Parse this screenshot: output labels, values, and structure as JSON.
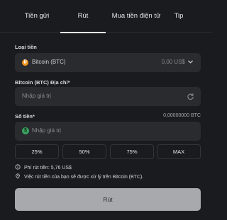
{
  "tabs": [
    {
      "label": "Tiền gửi"
    },
    {
      "label": "Rút"
    },
    {
      "label": "Mua tiền điện tử"
    },
    {
      "label": "Tip"
    }
  ],
  "currency": {
    "label": "Loại tiền",
    "selected": "Bitcoin (BTC)",
    "usd_value": "0,00 US$",
    "icon": "bitcoin-icon",
    "icon_color": "#f7931a"
  },
  "address": {
    "label": "Bitcoin (BTC) Địa chỉ*",
    "placeholder": "Nhập giá trị",
    "icon": "refresh-icon"
  },
  "amount": {
    "label": "Số tiền*",
    "balance": "0,00000000 BTC",
    "placeholder": "Nhập giá trị",
    "icon": "dollar-icon",
    "icon_color": "#3aa360"
  },
  "percent_buttons": [
    "25%",
    "50%",
    "75%",
    "MAX"
  ],
  "fee_text": "Phí rút tiền: 5,76 US$",
  "note_text": "Việc rút tiền của bạn sẽ được xử lý trên Bitcoin (BTC).",
  "submit_label": "Rút"
}
